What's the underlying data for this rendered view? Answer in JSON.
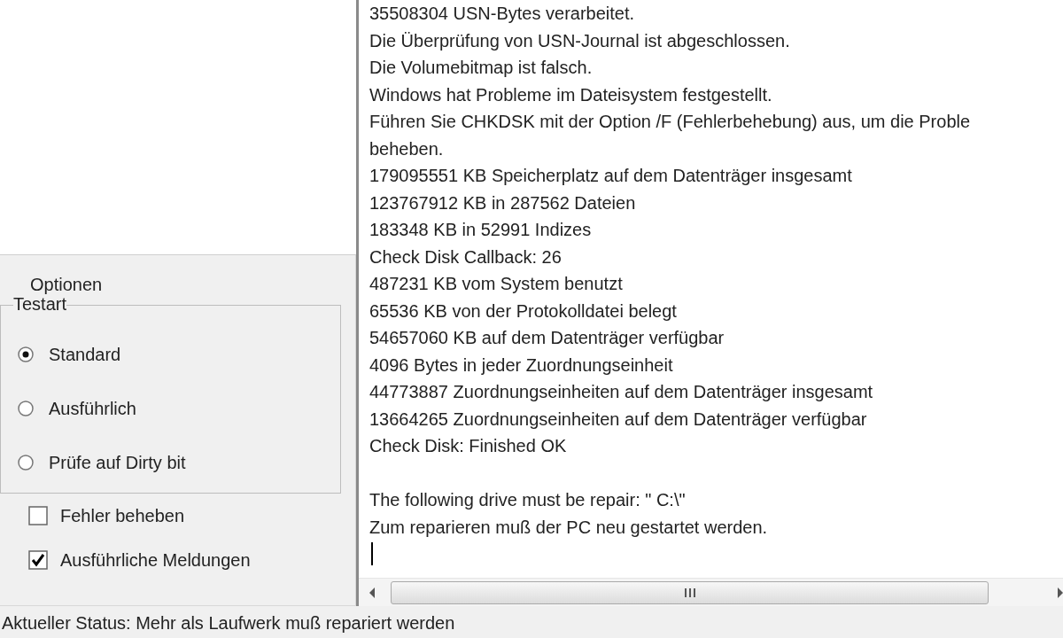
{
  "options": {
    "title": "Optionen",
    "test_type": {
      "legend": "Testart",
      "choices": [
        {
          "label": "Standard",
          "selected": true
        },
        {
          "label": "Ausführlich",
          "selected": false
        },
        {
          "label": "Prüfe auf Dirty bit",
          "selected": false
        }
      ]
    },
    "checkboxes": [
      {
        "label": "Fehler beheben",
        "checked": false
      },
      {
        "label": "Ausführliche Meldungen",
        "checked": true
      }
    ]
  },
  "log": {
    "blocks": [
      [
        "35508304 USN-Bytes verarbeitet.",
        "Die Überprüfung von USN-Journal ist abgeschlossen.",
        "Die Volumebitmap ist falsch.",
        "Windows hat Probleme im Dateisystem festgestellt.",
        "Führen Sie CHKDSK mit der Option /F (Fehlerbehebung) aus, um die Proble",
        "beheben.",
        "179095551 KB Speicherplatz auf dem Datenträger insgesamt",
        "123767912 KB in 287562 Dateien",
        "183348 KB in 52991 Indizes",
        "Check Disk Callback: 26",
        "487231 KB vom System benutzt",
        "65536 KB von der Protokolldatei belegt",
        "54657060 KB auf dem Datenträger verfügbar",
        "4096 Bytes in jeder Zuordnungseinheit",
        "44773887 Zuordnungseinheiten auf dem Datenträger insgesamt",
        "13664265 Zuordnungseinheiten auf dem Datenträger verfügbar",
        "Check Disk: Finished OK"
      ],
      [
        "The following drive must be repair: \" C:\\\"",
        "Zum reparieren muß der PC neu gestartet werden."
      ]
    ],
    "caret": true
  },
  "status_bar": "Aktueller Status: Mehr als Laufwerk muß repariert werden"
}
